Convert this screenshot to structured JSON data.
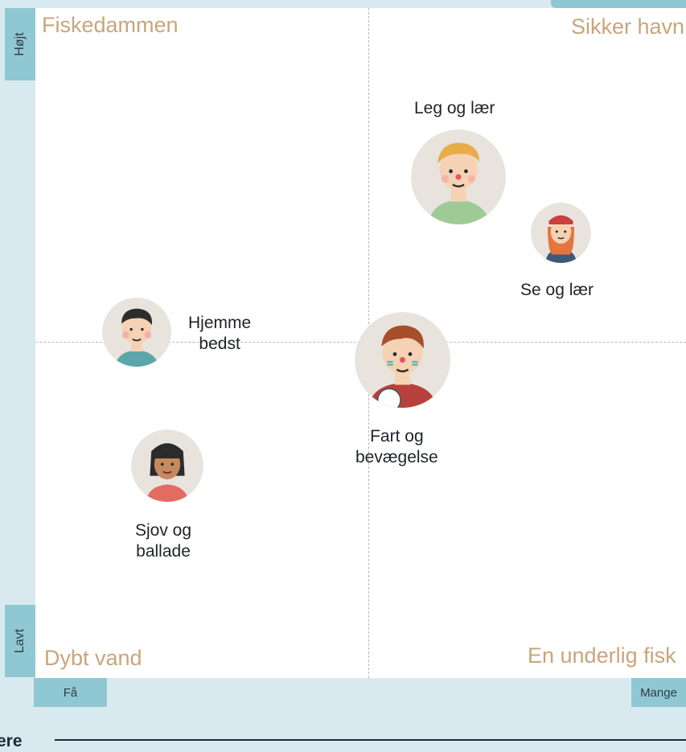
{
  "quadrants": {
    "top_left": "Fiskedammen",
    "top_right": "Sikker havn",
    "bottom_left": "Dybt vand",
    "bottom_right": "En underlig fisk"
  },
  "axes": {
    "y_high": "Højt",
    "y_low": "Lavt",
    "x_low": "Få",
    "x_high": "Mange"
  },
  "personas": [
    {
      "label": "Leg og lær",
      "avatar": "blond-boy-avatar"
    },
    {
      "label": "Se og lær",
      "avatar": "red-hair-girl-avatar"
    },
    {
      "label_line1": "Hjemme",
      "label_line2": "bedst",
      "avatar": "dark-hair-boy-avatar"
    },
    {
      "label_line1": "Fart og",
      "label_line2": "bevægelse",
      "avatar": "football-boy-avatar"
    },
    {
      "label_line1": "Sjov og",
      "label_line2": "ballade",
      "avatar": "bob-hair-girl-avatar"
    }
  ],
  "footer": {
    "label": "ere"
  },
  "colors": {
    "background": "#d8e9ef",
    "axis_tag": "#8fc8d3",
    "quadrant_text": "#c9a57b",
    "avatar_bg": "#e8e3dc",
    "divider": "#1e2a38"
  }
}
